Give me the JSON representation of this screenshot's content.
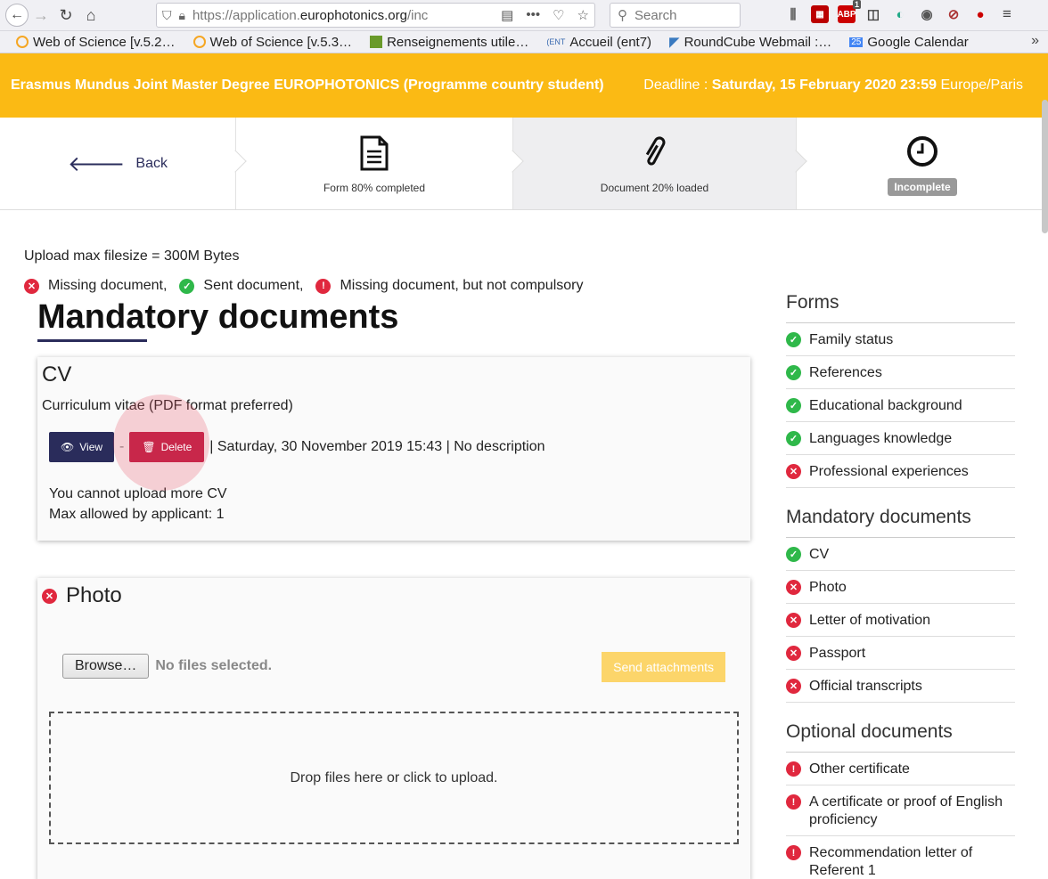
{
  "browser": {
    "url_prefix": "https://application.",
    "url_host": "europhotonics.org",
    "url_suffix": "/inc",
    "search_placeholder": "Search",
    "badge_count": "1",
    "bookmarks": [
      {
        "label": "Web of Science [v.5.2…",
        "color": "#f5a623"
      },
      {
        "label": "Web of Science [v.5.3…",
        "color": "#f5a623"
      },
      {
        "label": "Renseignements utile…",
        "color": "#6a9a2a"
      },
      {
        "label": "Accueil (ent7)",
        "color": "#3a6ab0"
      },
      {
        "label": "RoundCube Webmail :…",
        "color": "#3a7ac0"
      },
      {
        "label": "Google Calendar",
        "color": "#4285f4"
      }
    ],
    "calendar_day": "25"
  },
  "header": {
    "title": "Erasmus Mundus Joint Master Degree EUROPHOTONICS (Programme country student)",
    "deadline_label": "Deadline : ",
    "deadline_value": "Saturday, 15 February 2020 23:59",
    "timezone": " Europe/Paris",
    "color": "#fbba14"
  },
  "steps": {
    "back_label": "Back",
    "form_label": "Form 80% completed",
    "doc_label": "Document 20% loaded",
    "status_label": "Incomplete"
  },
  "info": {
    "upload_max": "Upload max filesize = 300M Bytes",
    "legend_missing": "Missing document,",
    "legend_sent": "Sent document,",
    "legend_optional": "Missing document, but not compulsory"
  },
  "main_title": "Mandatory documents",
  "cv": {
    "title": "CV",
    "description": "Curriculum vitae (PDF format preferred)",
    "view_label": "View",
    "separator": "-",
    "delete_label": "Delete",
    "file_info": "| Saturday, 30 November 2019 15:43 | No description",
    "cannot_upload": "You cannot upload more CV",
    "max_allowed": "Max allowed by applicant: 1"
  },
  "photo": {
    "title": "Photo",
    "browse_label": "Browse…",
    "no_files": "No files selected.",
    "send_label": "Send attachments",
    "dropzone": "Drop files here or click to upload."
  },
  "sidebar": {
    "forms_heading": "Forms",
    "forms": [
      {
        "label": "Family status",
        "status": "green"
      },
      {
        "label": "References",
        "status": "green"
      },
      {
        "label": "Educational background",
        "status": "green"
      },
      {
        "label": "Languages knowledge",
        "status": "green"
      },
      {
        "label": "Professional experiences",
        "status": "red"
      }
    ],
    "mandatory_heading": "Mandatory documents",
    "mandatory": [
      {
        "label": "CV",
        "status": "green"
      },
      {
        "label": "Photo",
        "status": "red"
      },
      {
        "label": "Letter of motivation",
        "status": "red"
      },
      {
        "label": "Passport",
        "status": "red"
      },
      {
        "label": "Official transcripts",
        "status": "red"
      }
    ],
    "optional_heading": "Optional documents",
    "optional": [
      {
        "label": "Other certificate",
        "status": "warn"
      },
      {
        "label": "A certificate or proof of English proficiency",
        "status": "warn"
      },
      {
        "label": "Recommendation letter of Referent 1",
        "status": "warn"
      }
    ]
  }
}
